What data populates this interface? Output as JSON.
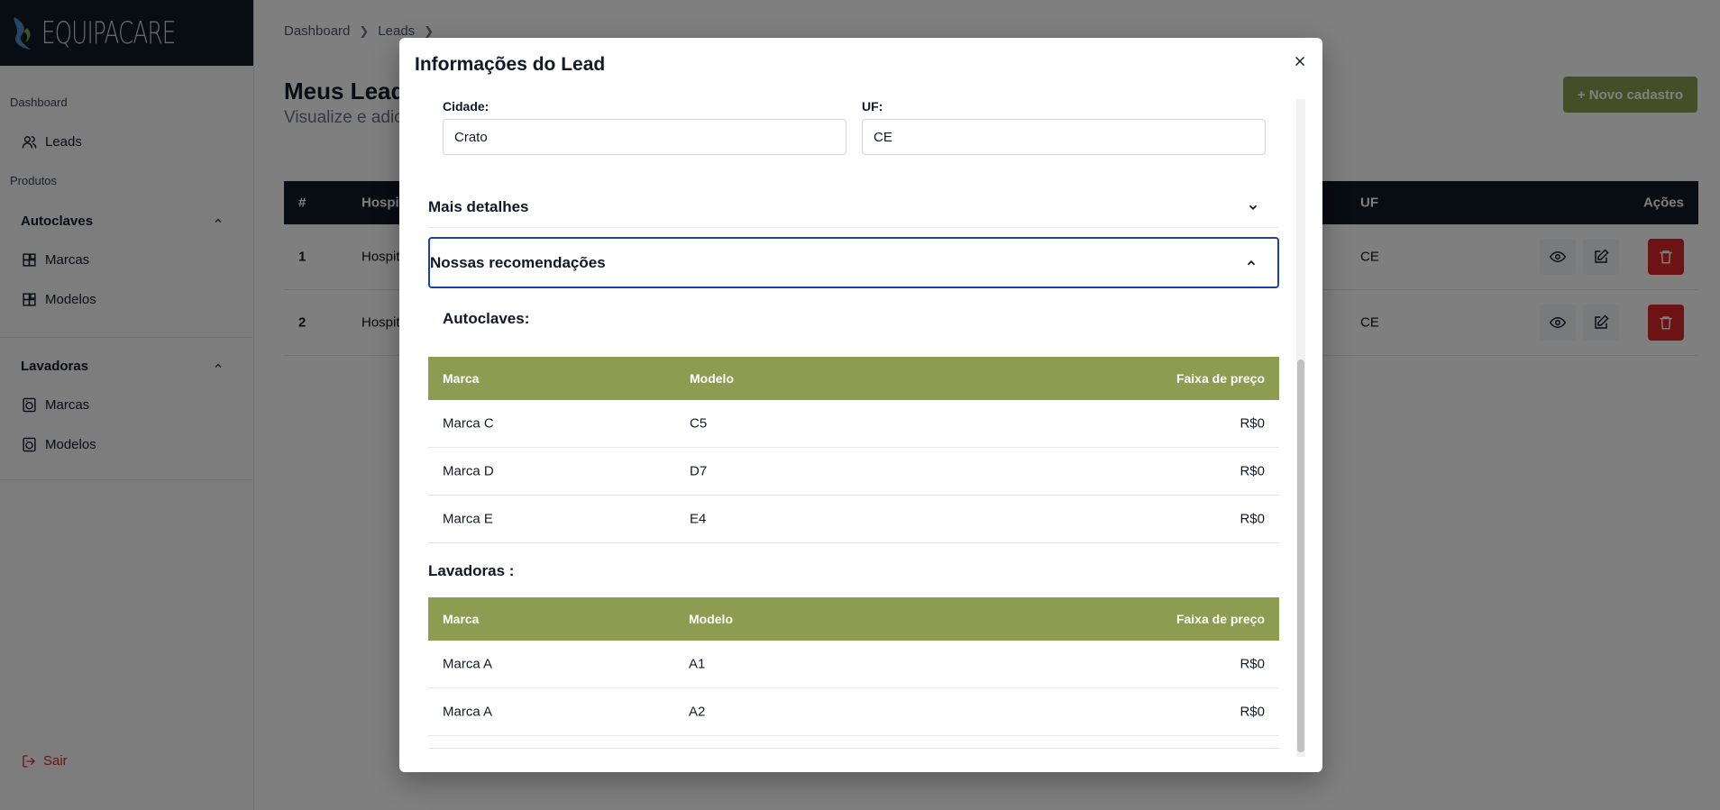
{
  "brand": {
    "logo_text": "EQUIPACARE"
  },
  "sidebar": {
    "section_dashboard": "Dashboard",
    "leads_label": "Leads",
    "section_produtos": "Produtos",
    "autoclaves": {
      "title": "Autoclaves",
      "items": [
        "Marcas",
        "Modelos"
      ]
    },
    "lavadoras": {
      "title": "Lavadoras",
      "items": [
        "Marcas",
        "Modelos"
      ]
    },
    "logout_label": "Sair"
  },
  "page": {
    "breadcrumb": [
      "Dashboard",
      "Leads"
    ],
    "title": "Meus Leads",
    "subtitle": "Visualize e adicione",
    "new_button": "+ Novo cadastro",
    "table": {
      "headers": {
        "num": "#",
        "hospital": "Hospital",
        "uf": "UF",
        "actions": "Ações"
      },
      "rows": [
        {
          "num": "1",
          "hospital": "Hospital",
          "uf": "CE"
        },
        {
          "num": "2",
          "hospital": "Hospital",
          "uf": "CE"
        }
      ]
    }
  },
  "modal": {
    "title": "Informações do Lead",
    "cidade": {
      "label": "Cidade:",
      "value": "Crato"
    },
    "uf": {
      "label": "UF:",
      "value": "CE"
    },
    "more_details": "Mais detalhes",
    "recommendations": "Nossas recomendações",
    "autoclaves_title": "Autoclaves:",
    "lavadoras_title": "Lavadoras :",
    "table_headers": {
      "marca": "Marca",
      "modelo": "Modelo",
      "preco": "Faixa de preço"
    },
    "autoclaves_rows": [
      {
        "marca": "Marca C",
        "modelo": "C5",
        "preco": "R$0"
      },
      {
        "marca": "Marca D",
        "modelo": "D7",
        "preco": "R$0"
      },
      {
        "marca": "Marca E",
        "modelo": "E4",
        "preco": "R$0"
      }
    ],
    "lavadoras_rows": [
      {
        "marca": "Marca A",
        "modelo": "A1",
        "preco": "R$0"
      },
      {
        "marca": "Marca A",
        "modelo": "A2",
        "preco": "R$0"
      }
    ]
  },
  "colors": {
    "accent": "#8d9c50",
    "danger": "#dc2626",
    "dark": "#111827",
    "focus": "#1e40af"
  }
}
